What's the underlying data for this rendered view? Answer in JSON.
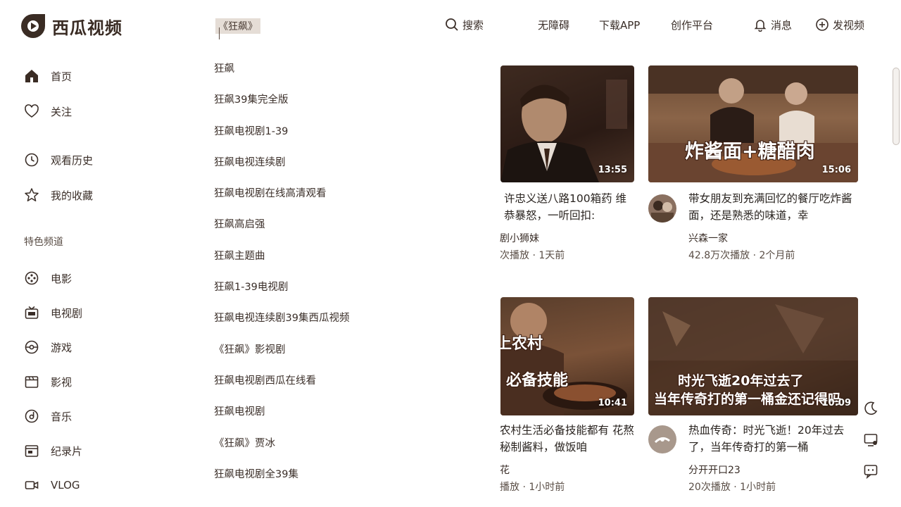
{
  "app": {
    "logo_text": "西瓜视频",
    "brand_color": "#3a2c24"
  },
  "search": {
    "value": "《狂飙》",
    "button_label": "搜索"
  },
  "topnav": {
    "accessibility": "无障碍",
    "download": "下载APP",
    "creator": "创作平台",
    "messages": "消息",
    "upload": "发视频"
  },
  "sidebar": {
    "items": [
      {
        "label": "首页",
        "icon": "home-icon"
      },
      {
        "label": "关注",
        "icon": "heart-icon"
      },
      {
        "label": "观看历史",
        "icon": "clock-icon"
      },
      {
        "label": "我的收藏",
        "icon": "star-icon"
      }
    ],
    "section_title": "特色频道",
    "channels": [
      {
        "label": "电影",
        "icon": "film-reel-icon"
      },
      {
        "label": "电视剧",
        "icon": "tv-icon"
      },
      {
        "label": "游戏",
        "icon": "gamepad-icon"
      },
      {
        "label": "影视",
        "icon": "clapperboard-icon"
      },
      {
        "label": "音乐",
        "icon": "music-disc-icon"
      },
      {
        "label": "纪录片",
        "icon": "documentary-icon"
      },
      {
        "label": "VLOG",
        "icon": "video-camera-icon"
      }
    ]
  },
  "suggestions": [
    "狂飙",
    "狂飙39集完全版",
    "狂飙电视剧1-39",
    "狂飙电视连续剧",
    "狂飙电视剧在线高清观看",
    "狂飙高启强",
    "狂飙主题曲",
    "狂飙1-39电视剧",
    "狂飙电视连续剧39集西瓜视频",
    "《狂飙》影视剧",
    "狂飙电视剧西瓜在线看",
    "狂飙电视剧",
    "《狂飙》贾冰",
    "狂飙电视剧全39集"
  ],
  "videos": [
    {
      "duration": "13:55",
      "title": "许忠义送八路100箱药 维恭暴怒，一听回扣:",
      "author": "剧小狮妹",
      "meta": "次播放 · 1天前"
    },
    {
      "duration": "15:06",
      "overlay": "炸酱面+糖醋肉",
      "title": "带女朋友到充满回忆的餐厅吃炸酱面，还是熟悉的味道，幸",
      "author": "兴森一家",
      "meta": "42.8万次播放 · 2个月前"
    },
    {
      "duration": "10:41",
      "overlay_top": "上农村",
      "overlay_bottom": "必备技能",
      "title": "农村生活必备技能都有 花熬秘制酱料，做饭咱",
      "author": "花",
      "meta": "播放 · 1小时前"
    },
    {
      "duration": "10:09",
      "overlay_top": "时光飞逝20年过去了",
      "overlay_bottom": "当年传奇打的第一桶金还记得吗",
      "title": "热血传奇：时光飞逝！20年过去了，当年传奇打的第一桶",
      "author": "分开开口23",
      "meta": "20次播放 · 1小时前"
    }
  ],
  "colors": {
    "text": "#2a2420",
    "muted": "#5a4e46",
    "thumb_dark": "#4a3226",
    "thumb_warm": "#8a5a3c"
  }
}
